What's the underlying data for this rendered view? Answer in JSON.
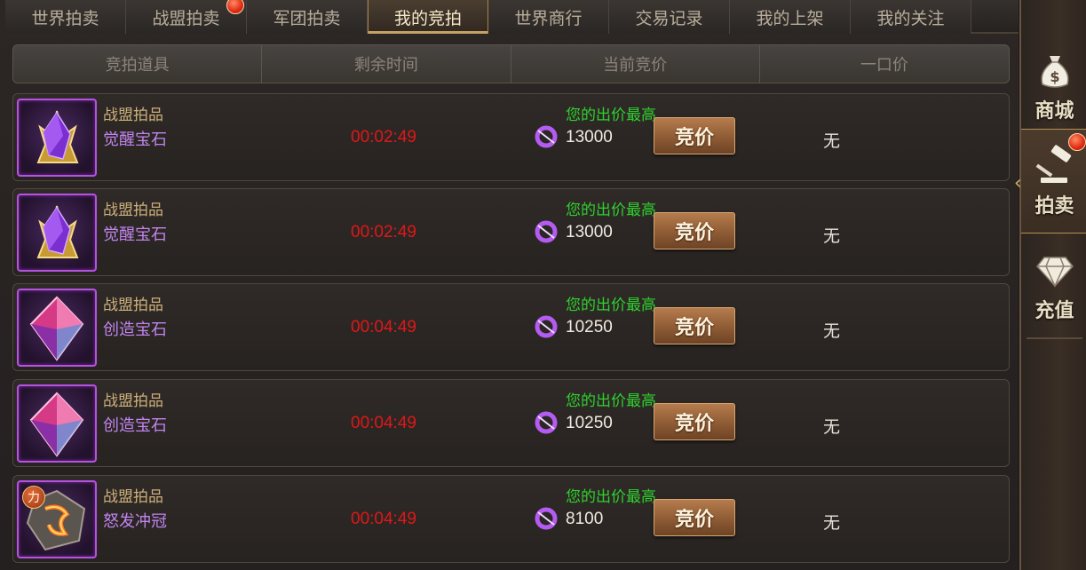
{
  "tabs": [
    {
      "label": "世界拍卖",
      "active": false,
      "dot": false
    },
    {
      "label": "战盟拍卖",
      "active": false,
      "dot": true
    },
    {
      "label": "军团拍卖",
      "active": false,
      "dot": false
    },
    {
      "label": "我的竞拍",
      "active": true,
      "dot": false
    },
    {
      "label": "世界商行",
      "active": false,
      "dot": false
    },
    {
      "label": "交易记录",
      "active": false,
      "dot": false
    },
    {
      "label": "我的上架",
      "active": false,
      "dot": false
    },
    {
      "label": "我的关注",
      "active": false,
      "dot": false
    }
  ],
  "table": {
    "headers": [
      "竞拍道具",
      "剩余时间",
      "当前竞价",
      "一口价"
    ],
    "rows": [
      {
        "source": "战盟拍品",
        "item": "觉醒宝石",
        "icon": "purple-crystal-gold-icon",
        "time": "00:02:49",
        "status": "您的出价最高",
        "price": "13000",
        "button": "竞价",
        "buyout": "无"
      },
      {
        "source": "战盟拍品",
        "item": "觉醒宝石",
        "icon": "purple-crystal-gold-icon",
        "time": "00:02:49",
        "status": "您的出价最高",
        "price": "13000",
        "button": "竞价",
        "buyout": "无"
      },
      {
        "source": "战盟拍品",
        "item": "创造宝石",
        "icon": "pink-diamond-icon",
        "time": "00:04:49",
        "status": "您的出价最高",
        "price": "10250",
        "button": "竞价",
        "buyout": "无"
      },
      {
        "source": "战盟拍品",
        "item": "创造宝石",
        "icon": "pink-diamond-icon",
        "time": "00:04:49",
        "status": "您的出价最高",
        "price": "10250",
        "button": "竞价",
        "buyout": "无"
      },
      {
        "source": "战盟拍品",
        "item": "怒发冲冠",
        "icon": "rune-stone-icon",
        "badge": "力",
        "time": "00:04:49",
        "status": "您的出价最高",
        "price": "8100",
        "button": "竞价",
        "buyout": "无"
      }
    ]
  },
  "sidebar": {
    "items": [
      {
        "label": "商城",
        "icon": "money-bag-icon",
        "active": false
      },
      {
        "label": "拍卖",
        "icon": "gavel-icon",
        "active": true,
        "dot": true
      },
      {
        "label": "充值",
        "icon": "diamond-icon",
        "active": false
      }
    ]
  },
  "colors": {
    "timer": "#e01818",
    "status": "#2ed12e",
    "item_name": "#c184ee",
    "source": "#cdb07a"
  }
}
